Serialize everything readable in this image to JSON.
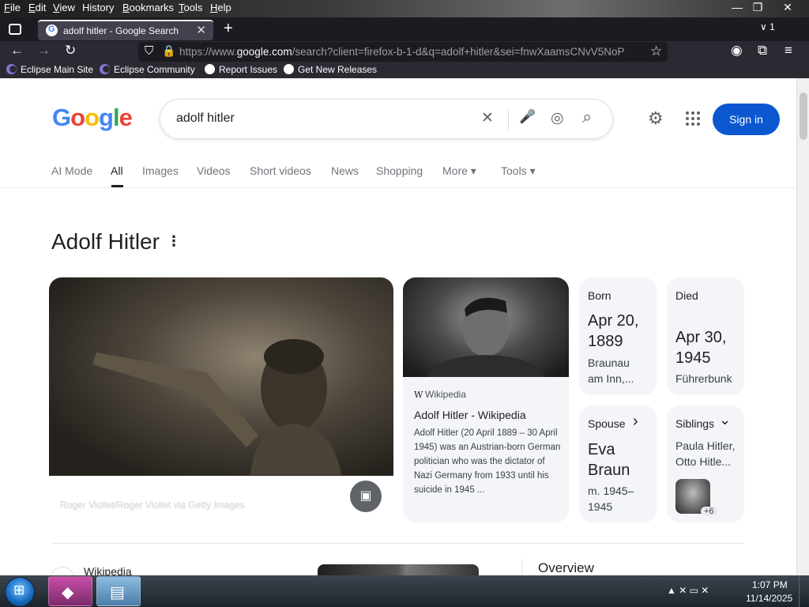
{
  "menubar": {
    "items": [
      {
        "label": "File",
        "u": "F",
        "rest": "ile"
      },
      {
        "label": "Edit",
        "u": "E",
        "rest": "dit"
      },
      {
        "label": "View",
        "u": "V",
        "rest": "iew"
      },
      {
        "label": "History",
        "u": "",
        "rest": "History"
      },
      {
        "label": "Bookmarks",
        "u": "B",
        "rest": "ookmarks"
      },
      {
        "label": "Tools",
        "u": "T",
        "rest": "ools"
      },
      {
        "label": "Help",
        "u": "H",
        "rest": "elp"
      }
    ],
    "window_controls": {
      "minimize": "—",
      "restore": "❐",
      "close": "✕"
    }
  },
  "tabbar": {
    "active_tab_title": "adolf hitler - Google Search",
    "favicon_letter": "G",
    "close_glyph": "✕",
    "new_tab_glyph": "+",
    "tab_count": "1",
    "tab_list_chevron": "∨"
  },
  "navbar": {
    "back_glyph": "←",
    "forward_glyph": "→",
    "reload_glyph": "↻",
    "url_prefix": "https://www.",
    "url_host": "google.com",
    "url_rest": "/search?client=firefox-b-1-d&q=adolf+hitler&sei=fnwXaamsCNvV5NoP",
    "star_glyph": "☆",
    "account_glyph": "◉",
    "extensions_glyph": "⧉",
    "menu_glyph": "≡"
  },
  "bookmarks": [
    {
      "label": "Eclipse Main Site",
      "icon": "eclipse-icon"
    },
    {
      "label": "Eclipse Community",
      "icon": "eclipse-icon"
    },
    {
      "label": "Report Issues",
      "icon": "github-icon"
    },
    {
      "label": "Get New Releases",
      "icon": "github-icon"
    }
  ],
  "google": {
    "logo_letters": [
      "G",
      "o",
      "o",
      "g",
      "l",
      "e"
    ],
    "logo_colors": [
      "#4285f4",
      "#ea4335",
      "#fbbc05",
      "#4285f4",
      "#34a853",
      "#ea4335"
    ],
    "search_query": "adolf hitler",
    "clear_glyph": "✕",
    "mic_glyph": "🎤",
    "lens_glyph": "◎",
    "search_glyph": "⌕",
    "settings_glyph": "⚙",
    "signin_label": "Sign in",
    "tabs": [
      "AI Mode",
      "All",
      "Images",
      "Videos",
      "Short videos",
      "News",
      "Shopping",
      "More ▾",
      "Tools ▾"
    ],
    "active_tab": "All"
  },
  "knowledge_panel": {
    "title": "Adolf Hitler",
    "more_glyph": "⋮",
    "photo_credit": "Roger Viollet/Roger Viollet via Getty Images",
    "image_search_glyph": "▣",
    "wiki": {
      "source": "Wikipedia",
      "source_icon": "W",
      "title": "Adolf Hitler - Wikipedia",
      "snippet": "Adolf Hitler (20 April 1889 – 30 April 1945) was an Austrian-born German politician who was the dictator of Nazi Germany from 1933 until his suicide in 1945 ..."
    },
    "facts": {
      "born": {
        "label": "Born",
        "line1": "Apr 20,",
        "line2": "1889",
        "sub1": "Braunau",
        "sub2": "am Inn,..."
      },
      "died": {
        "label": "Died",
        "line1": "Apr 30,",
        "line2": "1945",
        "sub1": "Führerbunk"
      },
      "spouse": {
        "label": "Spouse",
        "arrow": "›",
        "line1": "Eva",
        "line2": "Braun",
        "sub1": "m. 1945–",
        "sub2": "1945"
      },
      "siblings": {
        "label": "Siblings",
        "arrow": "⌄",
        "sub1": "Paula Hitler,",
        "sub2": "Otto Hitle...",
        "more": "+6"
      }
    },
    "result_source": "Wikipedia",
    "overview_title": "Overview"
  },
  "taskbar": {
    "start_glyph": "⊞",
    "tray_icons": "▲  ✕  ▭  ✕",
    "time": "1:07 PM",
    "date": "11/14/2025"
  }
}
